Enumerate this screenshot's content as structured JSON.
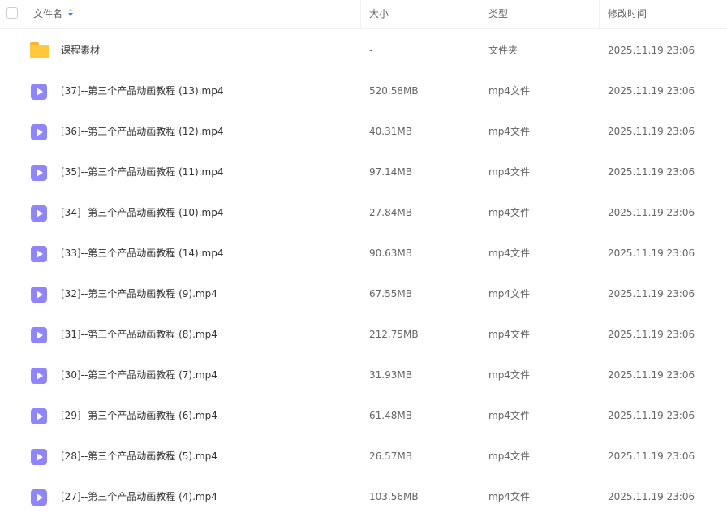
{
  "header": {
    "name_label": "文件名",
    "size_label": "大小",
    "type_label": "类型",
    "time_label": "修改时间"
  },
  "rows": [
    {
      "kind": "folder-icon",
      "name": "课程素材",
      "size": "-",
      "type": "文件夹",
      "time": "2025.11.19 23:06"
    },
    {
      "kind": "video-icon",
      "name": "[37]--第三个产品动画教程 (13).mp4",
      "size": "520.58MB",
      "type": "mp4文件",
      "time": "2025.11.19 23:06"
    },
    {
      "kind": "video-icon",
      "name": "[36]--第三个产品动画教程 (12).mp4",
      "size": "40.31MB",
      "type": "mp4文件",
      "time": "2025.11.19 23:06"
    },
    {
      "kind": "video-icon",
      "name": "[35]--第三个产品动画教程 (11).mp4",
      "size": "97.14MB",
      "type": "mp4文件",
      "time": "2025.11.19 23:06"
    },
    {
      "kind": "video-icon",
      "name": "[34]--第三个产品动画教程 (10).mp4",
      "size": "27.84MB",
      "type": "mp4文件",
      "time": "2025.11.19 23:06"
    },
    {
      "kind": "video-icon",
      "name": "[33]--第三个产品动画教程 (14).mp4",
      "size": "90.63MB",
      "type": "mp4文件",
      "time": "2025.11.19 23:06"
    },
    {
      "kind": "video-icon",
      "name": "[32]--第三个产品动画教程 (9).mp4",
      "size": "67.55MB",
      "type": "mp4文件",
      "time": "2025.11.19 23:06"
    },
    {
      "kind": "video-icon",
      "name": "[31]--第三个产品动画教程 (8).mp4",
      "size": "212.75MB",
      "type": "mp4文件",
      "time": "2025.11.19 23:06"
    },
    {
      "kind": "video-icon",
      "name": "[30]--第三个产品动画教程 (7).mp4",
      "size": "31.93MB",
      "type": "mp4文件",
      "time": "2025.11.19 23:06"
    },
    {
      "kind": "video-icon",
      "name": "[29]--第三个产品动画教程 (6).mp4",
      "size": "61.48MB",
      "type": "mp4文件",
      "time": "2025.11.19 23:06"
    },
    {
      "kind": "video-icon",
      "name": "[28]--第三个产品动画教程 (5).mp4",
      "size": "26.57MB",
      "type": "mp4文件",
      "time": "2025.11.19 23:06"
    },
    {
      "kind": "video-icon",
      "name": "[27]--第三个产品动画教程 (4).mp4",
      "size": "103.56MB",
      "type": "mp4文件",
      "time": "2025.11.19 23:06"
    }
  ]
}
